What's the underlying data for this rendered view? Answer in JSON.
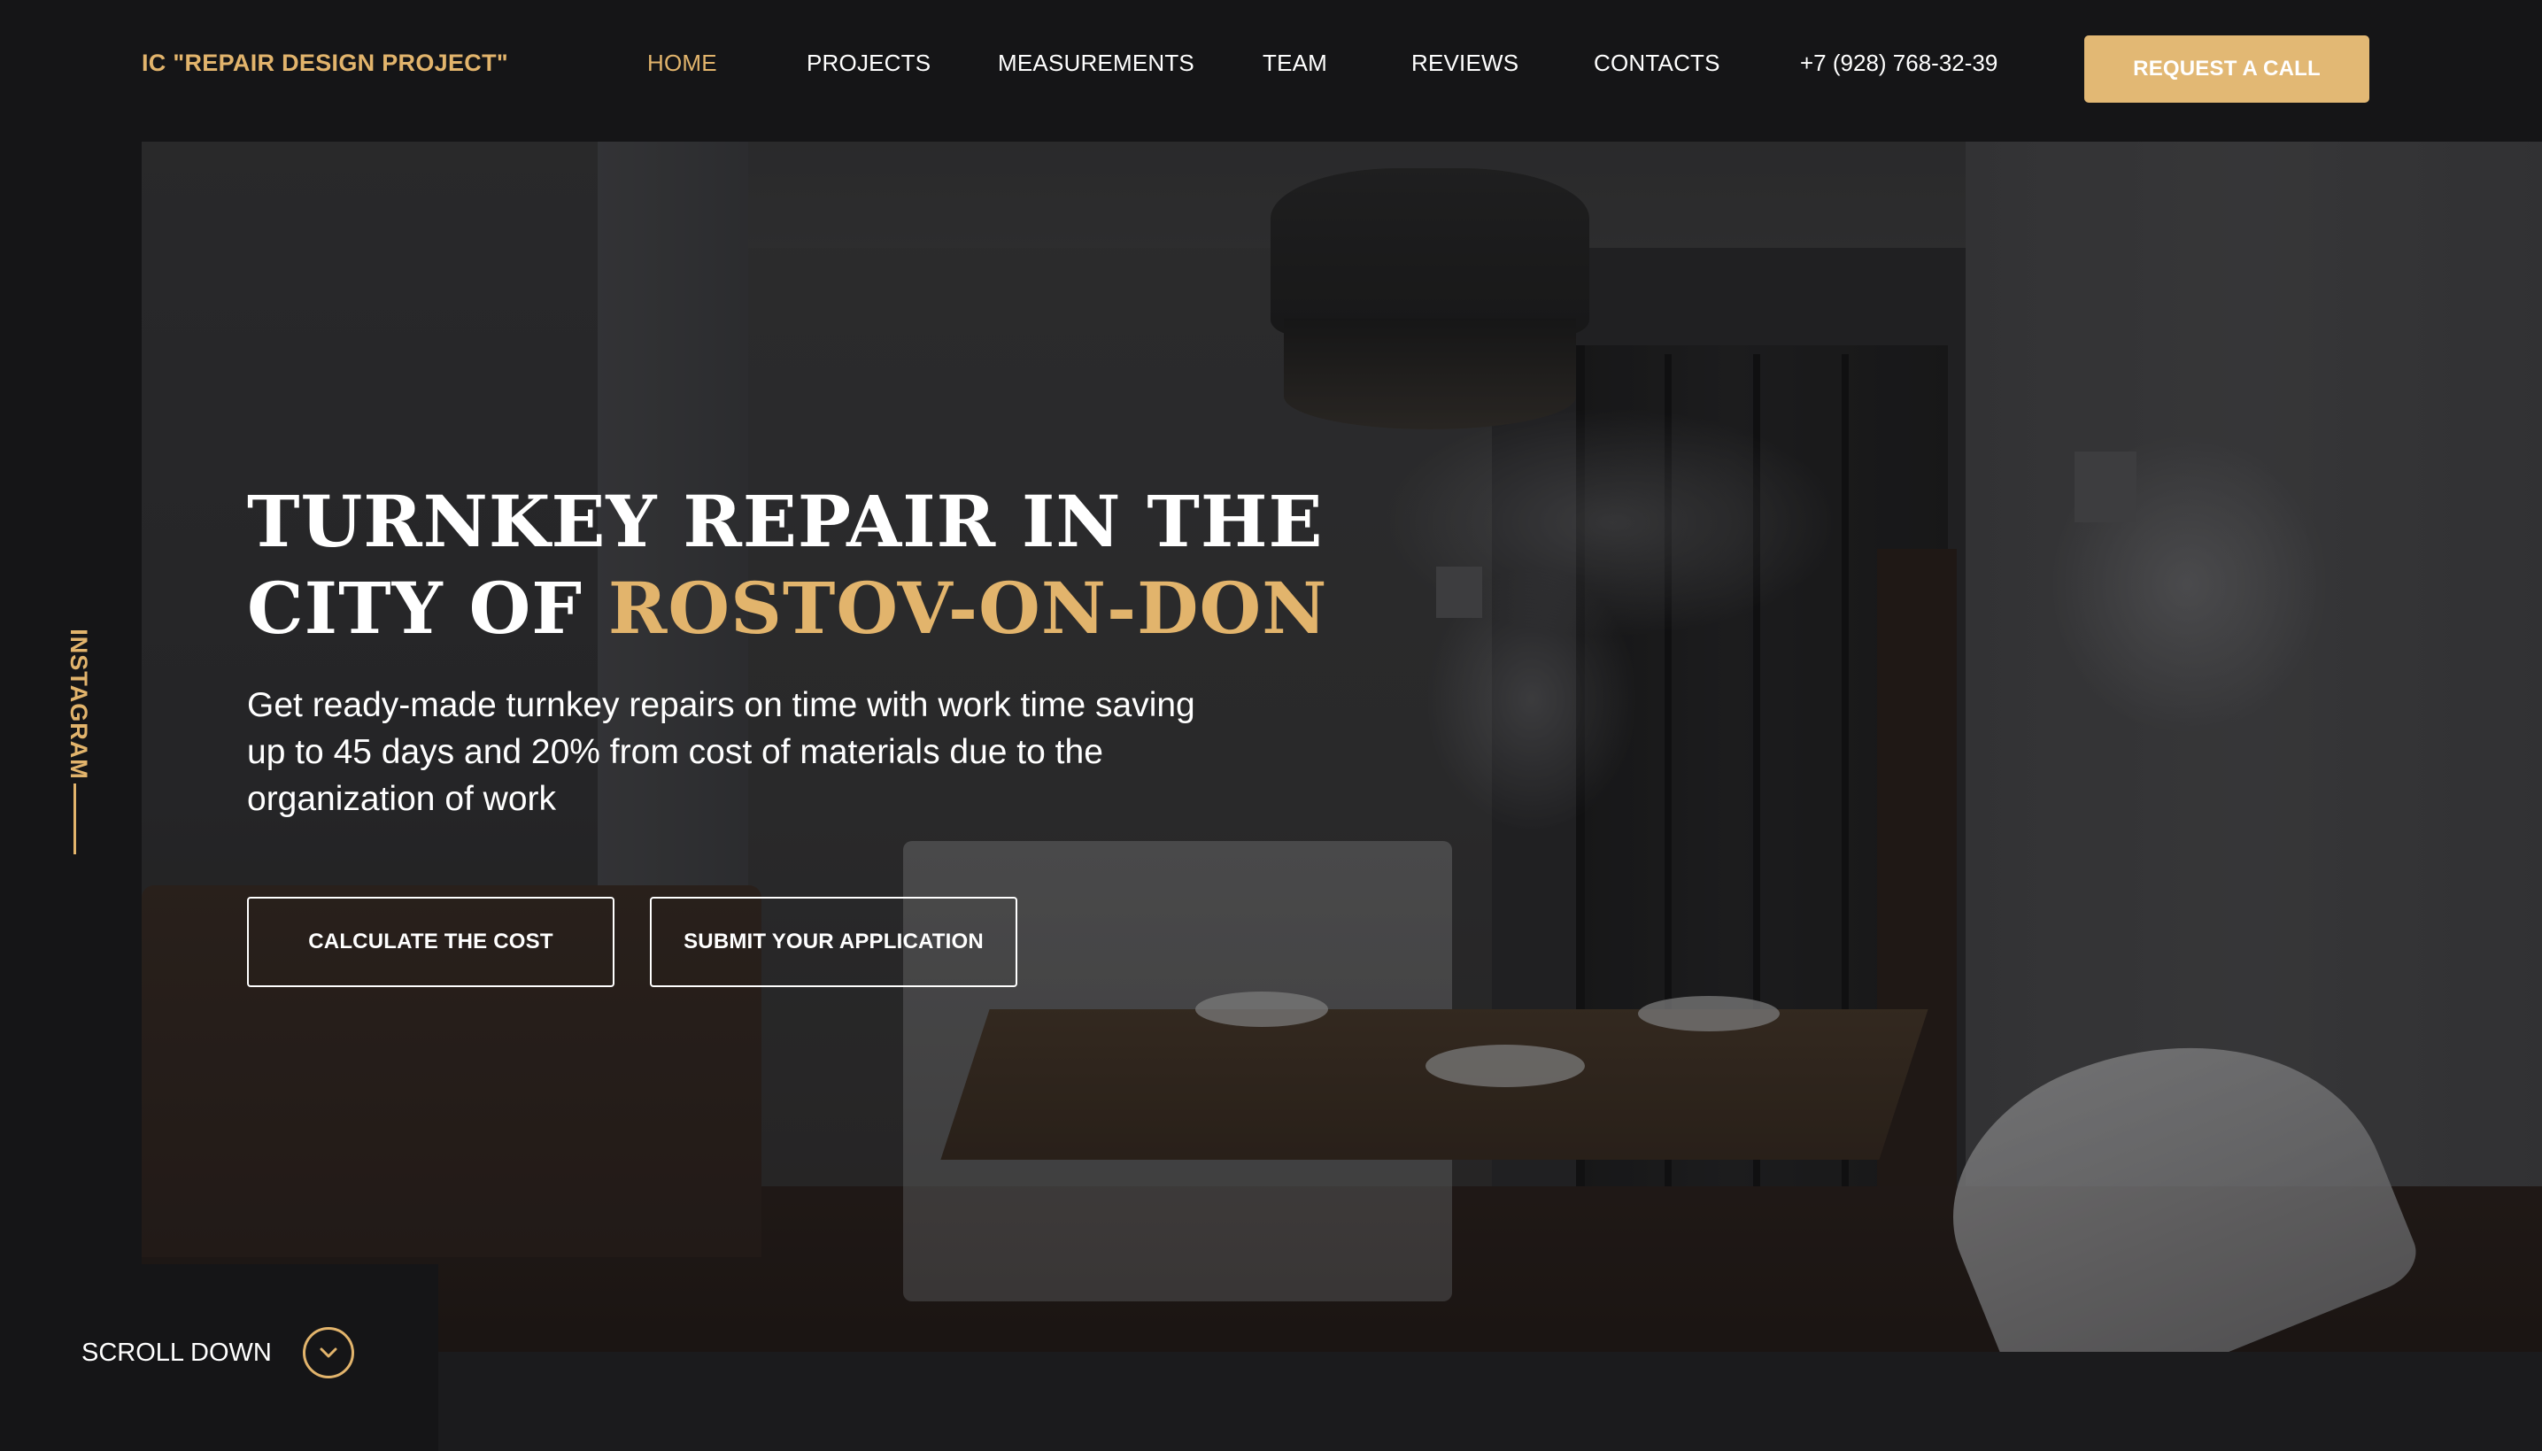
{
  "header": {
    "logo": "IC \"REPAIR DESIGN PROJECT\"",
    "nav": [
      {
        "label": "HOME",
        "active": true
      },
      {
        "label": "PROJECTS",
        "active": false
      },
      {
        "label": "MEASUREMENTS",
        "active": false
      },
      {
        "label": "TEAM",
        "active": false
      },
      {
        "label": "REVIEWS",
        "active": false
      },
      {
        "label": "CONTACTS",
        "active": false
      }
    ],
    "phone": "+7 (928) 768-32-39",
    "cta_label": "REQUEST A CALL"
  },
  "hero": {
    "title_line1": "TURNKEY REPAIR IN THE",
    "title_line2_prefix": "CITY OF ",
    "title_line2_accent": "ROSTOV-ON-DON",
    "subtitle": "Get ready-made turnkey repairs on time with work time saving up to 45 days and 20% from cost of materials due to the organization of work",
    "button_calculate": "CALCULATE THE COST",
    "button_submit": "SUBMIT YOUR APPLICATION"
  },
  "sidebar": {
    "social_label": "INSTAGRAM"
  },
  "scroll": {
    "label": "SCROLL DOWN",
    "icon": "chevron-down-icon"
  },
  "colors": {
    "accent": "#e2b46c",
    "background": "#151517",
    "button": "#e2b874"
  }
}
